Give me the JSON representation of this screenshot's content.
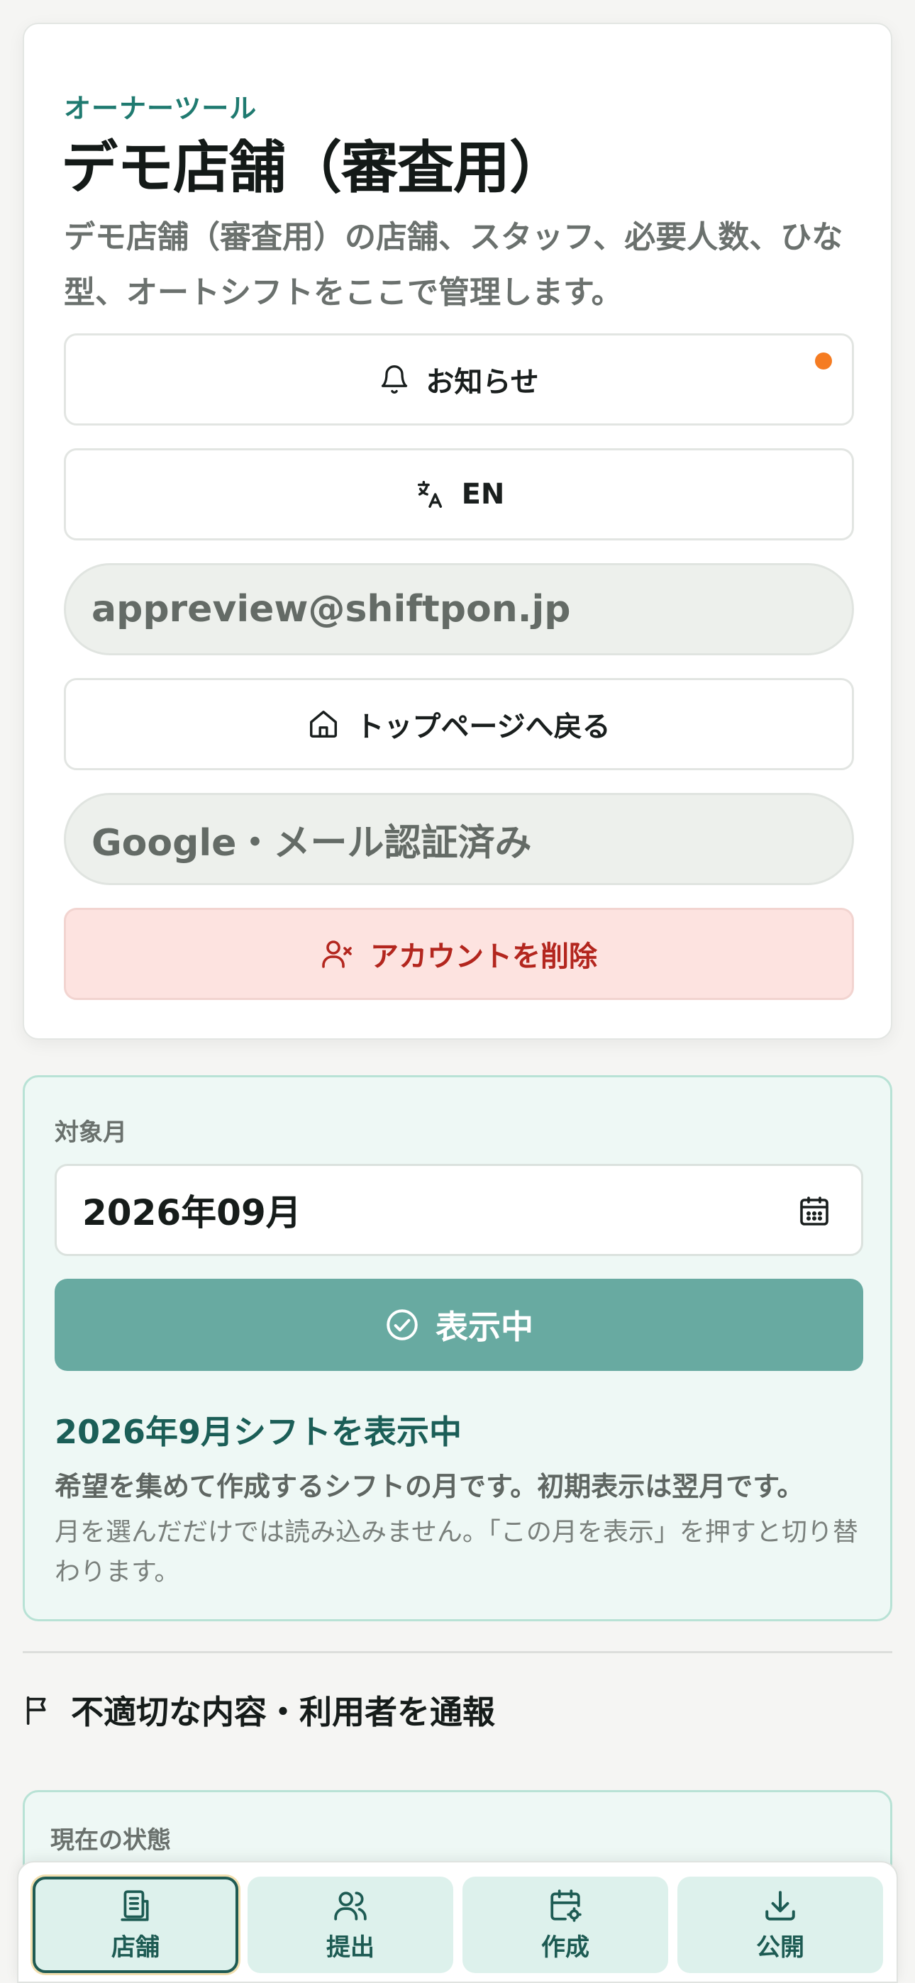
{
  "owner": {
    "eyebrow": "オーナーツール",
    "store_title": "デモ店舗（審査用）",
    "description": "デモ店舗（審査用）の店舗、スタッフ、必要人数、ひな型、オートシフトをここで管理します。",
    "notifications_label": "お知らせ",
    "language_label": "EN",
    "email": "appreview@shiftpon.jp",
    "back_to_top_label": "トップページへ戻る",
    "auth_status": "Google・メール認証済み",
    "delete_account_label": "アカウントを削除",
    "notification_dot_color": "#f57c22"
  },
  "month": {
    "label": "対象月",
    "value": "2026年09月",
    "show_button": "表示中",
    "heading": "2026年9月シフトを表示中",
    "explanation": "希望を集めて作成するシフトの月です。初期表示は翌月です。",
    "note": "月を選んだだけでは読み込みません。「この月を表示」を押すと切り替わります。"
  },
  "report": {
    "label": "不適切な内容・利用者を通報"
  },
  "status": {
    "label": "現在の状態"
  },
  "nav": {
    "tabs": [
      {
        "label": "店舗",
        "icon": "store-icon",
        "active": true
      },
      {
        "label": "提出",
        "icon": "users-icon",
        "active": false
      },
      {
        "label": "作成",
        "icon": "calendar-settings-icon",
        "active": false
      },
      {
        "label": "公開",
        "icon": "download-icon",
        "active": false
      }
    ]
  }
}
